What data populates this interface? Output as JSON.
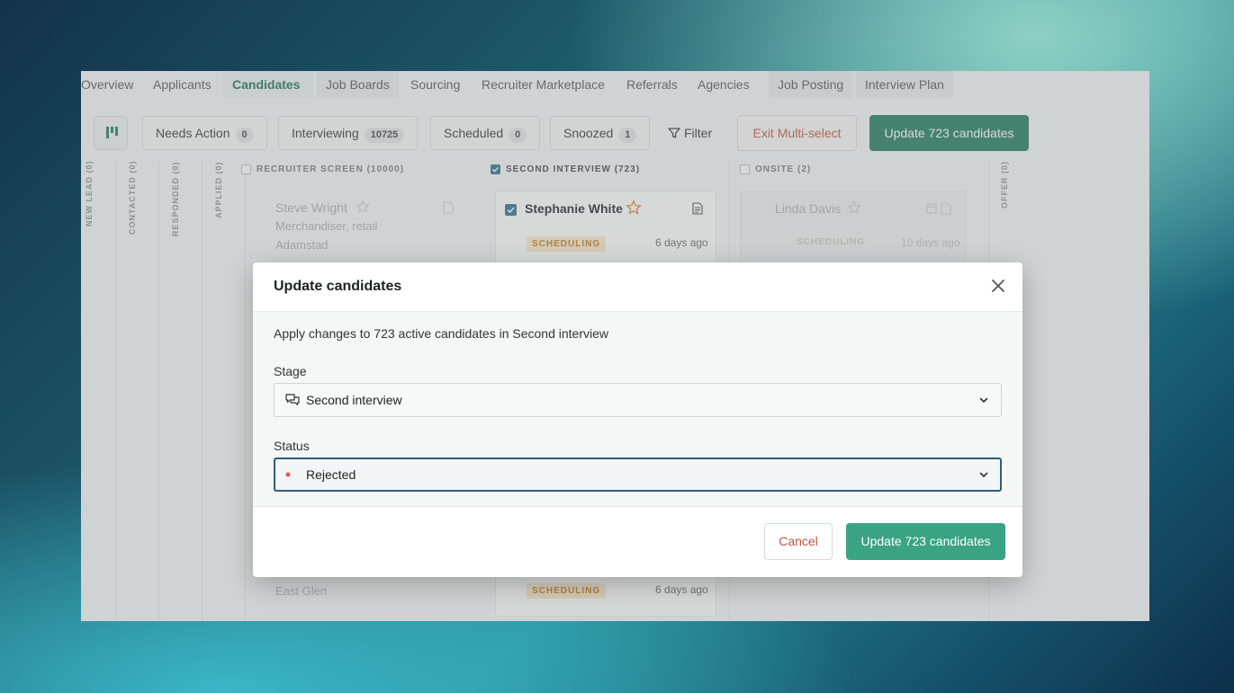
{
  "tabs": [
    {
      "label": "Overview"
    },
    {
      "label": "Applicants"
    },
    {
      "label": "Candidates"
    },
    {
      "label": "Job Boards"
    },
    {
      "label": "Sourcing"
    },
    {
      "label": "Recruiter Marketplace"
    },
    {
      "label": "Referrals"
    },
    {
      "label": "Agencies"
    },
    {
      "label": "Job Posting"
    },
    {
      "label": "Interview Plan"
    }
  ],
  "toolbar": {
    "needs_action": {
      "label": "Needs Action",
      "count": "0"
    },
    "interviewing": {
      "label": "Interviewing",
      "count": "10725"
    },
    "scheduled": {
      "label": "Scheduled",
      "count": "0"
    },
    "snoozed": {
      "label": "Snoozed",
      "count": "1"
    },
    "filter_label": "Filter",
    "exit_label": "Exit Multi-select",
    "update_label": "Update 723 candidates"
  },
  "stages_vertical": [
    {
      "label": "NEW LEAD (0)"
    },
    {
      "label": "CONTACTED (0)"
    },
    {
      "label": "RESPONDED (0)"
    },
    {
      "label": "APPLIED (0)"
    }
  ],
  "columns": {
    "recruiter_screen": {
      "header": "RECRUITER SCREEN (10000)",
      "card": {
        "name": "Steve Wright",
        "title": "Merchandiser, retail",
        "location": "Adamstad"
      },
      "bottom_location": "East Glen"
    },
    "second_interview": {
      "header": "SECOND INTERVIEW (723)",
      "card": {
        "name": "Stephanie White",
        "badge": "SCHEDULING",
        "ago": "6 days ago"
      },
      "bottom_card": {
        "badge": "SCHEDULING",
        "ago": "6 days ago"
      }
    },
    "onsite": {
      "header": "ONSITE (2)",
      "card": {
        "name": "Linda Davis",
        "badge": "SCHEDULING",
        "ago": "10 days ago"
      }
    },
    "offer": {
      "header": "OFFER (0)"
    }
  },
  "modal": {
    "title": "Update candidates",
    "description": "Apply changes to 723 active candidates in Second interview",
    "stage_label": "Stage",
    "stage_value": "Second interview",
    "status_label": "Status",
    "status_value": "Rejected",
    "cancel_label": "Cancel",
    "confirm_label": "Update 723 candidates"
  },
  "colors": {
    "accent": "#1f7a5c",
    "confirm": "#3aa383",
    "danger": "#c0533f",
    "rejected_dot": "#e05a4f"
  }
}
